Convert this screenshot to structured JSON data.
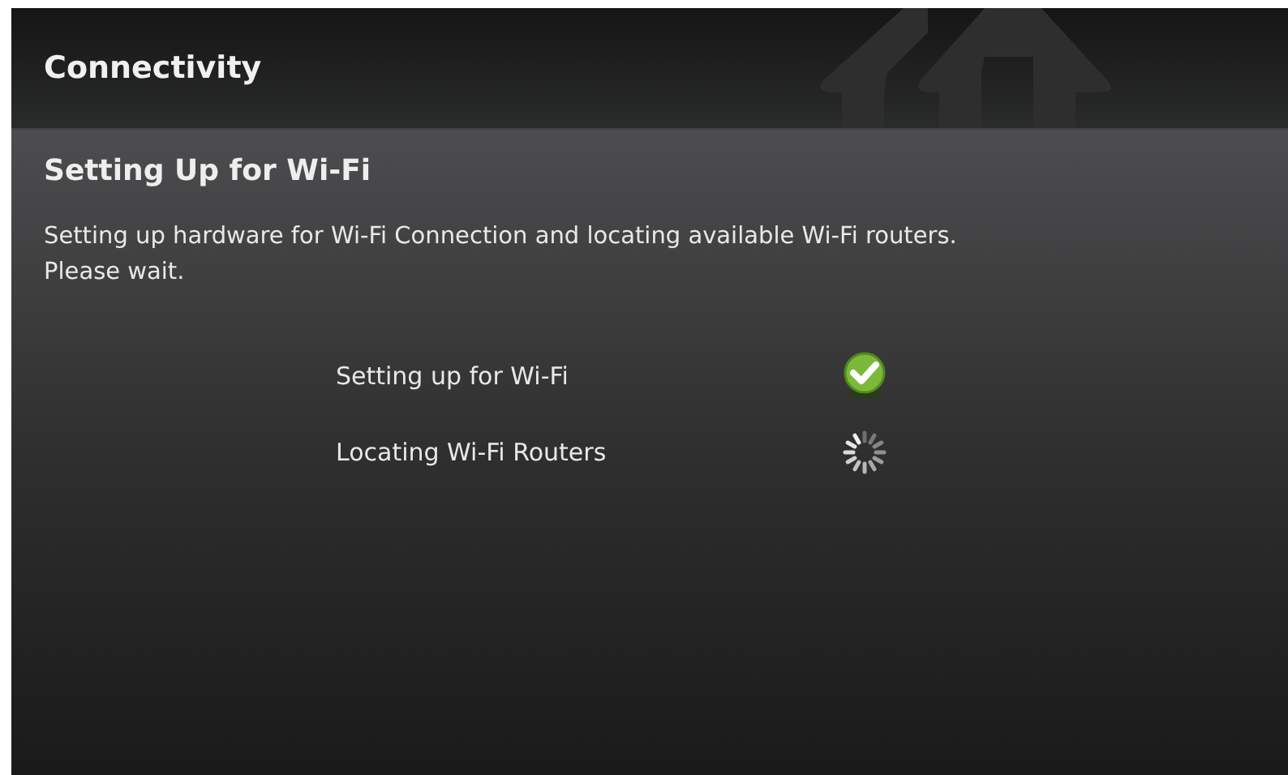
{
  "header": {
    "title": "Connectivity"
  },
  "page": {
    "heading": "Setting Up for Wi-Fi",
    "description": "Setting up hardware for Wi-Fi Connection and locating available Wi-Fi routers.  Please wait."
  },
  "steps": [
    {
      "label": "Setting up for Wi-Fi",
      "kind": "done"
    },
    {
      "label": "Locating Wi-Fi Routers",
      "kind": "pending"
    }
  ]
}
